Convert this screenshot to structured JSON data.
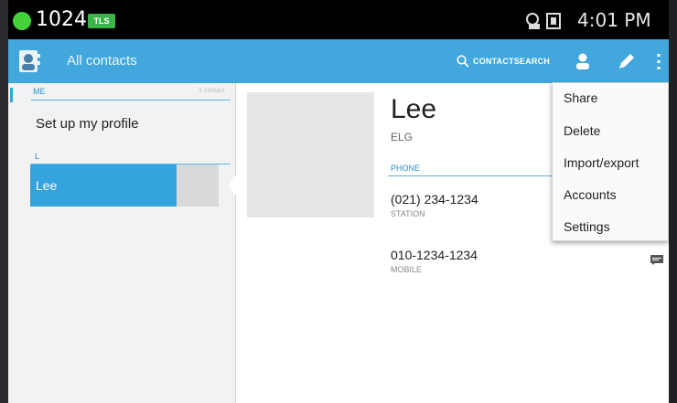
{
  "status_bar": {
    "count": "1024",
    "badge": "TLS",
    "time": "4:01 PM"
  },
  "action_bar": {
    "title": "All contacts",
    "search_label": "CONTACTSEARCH"
  },
  "list": {
    "me_header": "ME",
    "contacts_count": "1 contact",
    "setup_profile": "Set up my profile",
    "letter_header": "L",
    "selected_contact": "Lee"
  },
  "detail": {
    "name": "Lee",
    "organization": "ELG",
    "phone_header": "PHONE",
    "phones": [
      {
        "number": "(021) 234-1234",
        "type": "STATION"
      },
      {
        "number": "010-1234-1234",
        "type": "MOBILE"
      }
    ]
  },
  "menu": {
    "items": [
      "Share",
      "Delete",
      "Import/export",
      "Accounts",
      "Settings"
    ]
  },
  "colors": {
    "accent": "#41a7dc",
    "selected": "#35a3dd",
    "status_dot": "#43d23a"
  }
}
